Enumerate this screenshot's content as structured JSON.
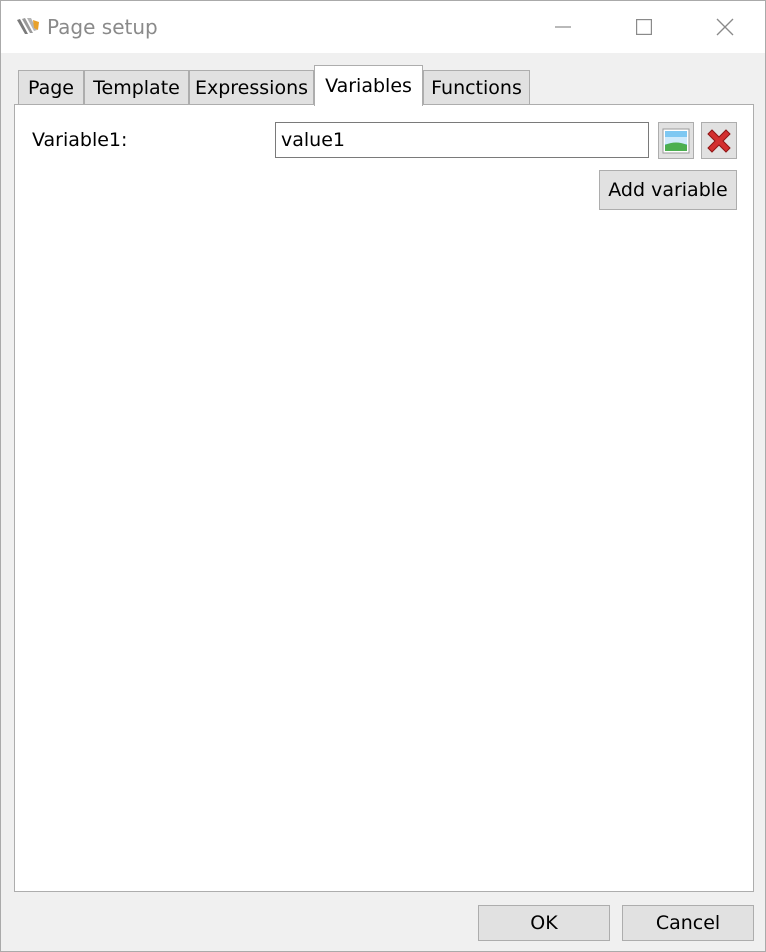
{
  "window": {
    "title": "Page setup",
    "app_icon": "page-setup-app-icon",
    "controls": {
      "minimize_icon": "minimize-icon",
      "maximize_icon": "maximize-icon",
      "close_icon": "close-icon"
    }
  },
  "tabs": [
    {
      "label": "Page",
      "active": false
    },
    {
      "label": "Template",
      "active": false
    },
    {
      "label": "Expressions",
      "active": false
    },
    {
      "label": "Variables",
      "active": true
    },
    {
      "label": "Functions",
      "active": false
    }
  ],
  "variables": {
    "items": [
      {
        "label": "Variable1:",
        "value": "value1",
        "edit_icon": "image-icon",
        "remove_icon": "red-x-icon"
      }
    ],
    "add_label": "Add variable"
  },
  "footer": {
    "ok_label": "OK",
    "cancel_label": "Cancel"
  },
  "colors": {
    "accent_green": "#4caf50",
    "remove_red": "#d32f2f",
    "icon_blue": "#3ba0e8"
  }
}
